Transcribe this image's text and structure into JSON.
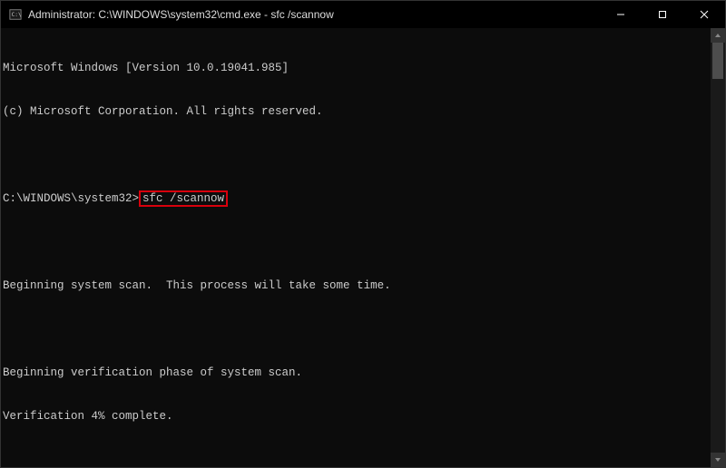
{
  "titlebar": {
    "title": "Administrator: C:\\WINDOWS\\system32\\cmd.exe - sfc  /scannow"
  },
  "terminal": {
    "version_line": "Microsoft Windows [Version 10.0.19041.985]",
    "copyright_line": "(c) Microsoft Corporation. All rights reserved.",
    "prompt": "C:\\WINDOWS\\system32>",
    "command": "sfc /scannow",
    "scan_begin": "Beginning system scan.  This process will take some time.",
    "verify_begin": "Beginning verification phase of system scan.",
    "verify_progress": "Verification 4% complete."
  }
}
